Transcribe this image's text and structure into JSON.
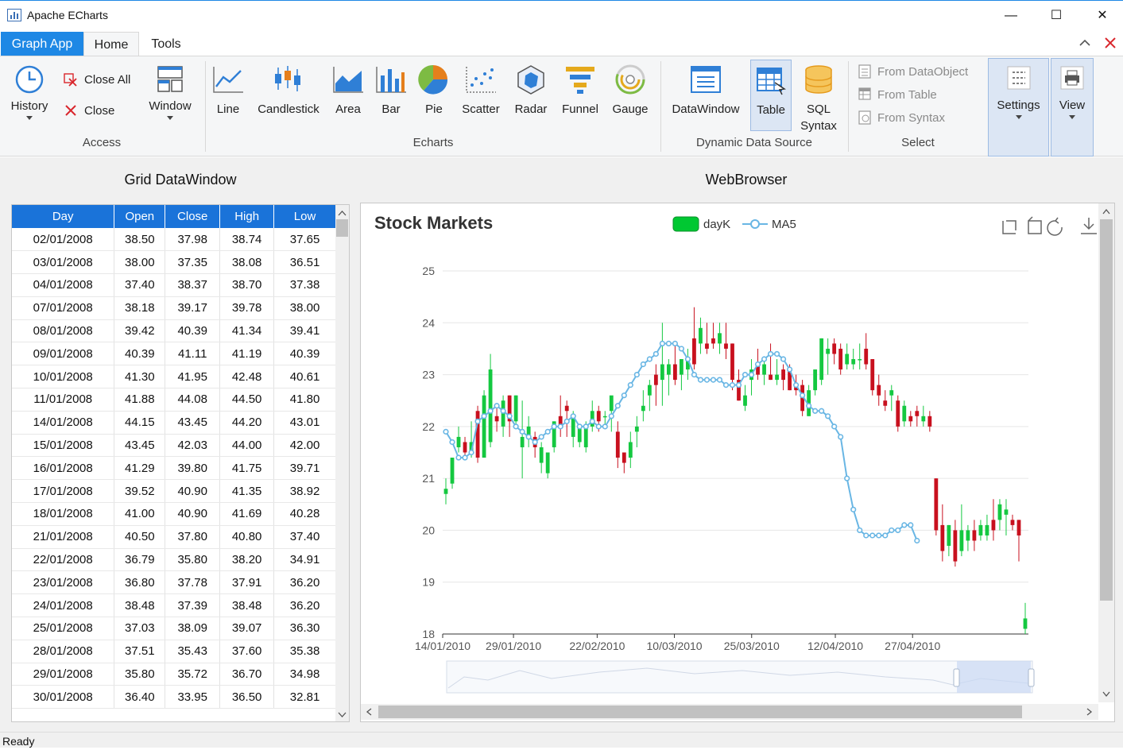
{
  "window": {
    "title": "Apache ECharts",
    "minimize": "—",
    "maximize": "☐",
    "close": "✕"
  },
  "tabs": {
    "app": "Graph App",
    "home": "Home",
    "tools": "Tools"
  },
  "ribbon": {
    "access": {
      "history": "History",
      "close_all": "Close All",
      "close": "Close",
      "window": "Window",
      "group": "Access"
    },
    "echarts": {
      "items": [
        "Line",
        "Candlestick",
        "Area",
        "Bar",
        "Pie",
        "Scatter",
        "Radar",
        "Funnel",
        "Gauge"
      ],
      "group": "Echarts"
    },
    "dds": {
      "datawindow": "DataWindow",
      "table": "Table",
      "sql": "SQL",
      "syntax": "Syntax",
      "group": "Dynamic Data Source"
    },
    "select": {
      "from_dataobject": "From DataObject",
      "from_table": "From Table",
      "from_syntax": "From Syntax",
      "group": "Select"
    },
    "settings": "Settings",
    "view": "View"
  },
  "panes": {
    "left_title": "Grid DataWindow",
    "right_title": "WebBrowser"
  },
  "grid": {
    "columns": [
      "Day",
      "Open",
      "Close",
      "High",
      "Low"
    ],
    "rows": [
      [
        "02/01/2008",
        "38.50",
        "37.98",
        "38.74",
        "37.65"
      ],
      [
        "03/01/2008",
        "38.00",
        "37.35",
        "38.08",
        "36.51"
      ],
      [
        "04/01/2008",
        "37.40",
        "38.37",
        "38.70",
        "37.38"
      ],
      [
        "07/01/2008",
        "38.18",
        "39.17",
        "39.78",
        "38.00"
      ],
      [
        "08/01/2008",
        "39.42",
        "40.39",
        "41.34",
        "39.41"
      ],
      [
        "09/01/2008",
        "40.39",
        "41.11",
        "41.19",
        "40.39"
      ],
      [
        "10/01/2008",
        "41.30",
        "41.95",
        "42.48",
        "40.61"
      ],
      [
        "11/01/2008",
        "41.88",
        "44.08",
        "44.50",
        "41.80"
      ],
      [
        "14/01/2008",
        "44.15",
        "43.45",
        "44.20",
        "43.01"
      ],
      [
        "15/01/2008",
        "43.45",
        "42.03",
        "44.00",
        "42.00"
      ],
      [
        "16/01/2008",
        "41.29",
        "39.80",
        "41.75",
        "39.71"
      ],
      [
        "17/01/2008",
        "39.52",
        "40.90",
        "41.35",
        "38.92"
      ],
      [
        "18/01/2008",
        "41.00",
        "40.90",
        "41.69",
        "40.28"
      ],
      [
        "21/01/2008",
        "40.50",
        "37.80",
        "40.80",
        "37.40"
      ],
      [
        "22/01/2008",
        "36.79",
        "35.80",
        "38.20",
        "34.91"
      ],
      [
        "23/01/2008",
        "36.80",
        "37.78",
        "37.91",
        "36.20"
      ],
      [
        "24/01/2008",
        "38.48",
        "37.39",
        "38.48",
        "36.20"
      ],
      [
        "25/01/2008",
        "37.03",
        "38.09",
        "39.07",
        "36.30"
      ],
      [
        "28/01/2008",
        "37.51",
        "35.43",
        "37.60",
        "35.38"
      ],
      [
        "29/01/2008",
        "35.80",
        "35.72",
        "36.70",
        "34.98"
      ],
      [
        "30/01/2008",
        "36.40",
        "33.95",
        "36.50",
        "32.81"
      ]
    ]
  },
  "status": "Ready",
  "colors": {
    "up": "#14c840",
    "down": "#c8101e",
    "ma": "#69b6e4",
    "accent": "#1e88e5"
  },
  "chart_data": {
    "type": "candlestick",
    "title": "Stock Markets",
    "legend": [
      "dayK",
      "MA5"
    ],
    "legend_position": "top-center",
    "yticks": [
      "25",
      "24",
      "23",
      "22",
      "21",
      "20",
      "19",
      "18"
    ],
    "ylim": [
      18,
      25
    ],
    "xticks": [
      "14/01/2010",
      "29/01/2010",
      "22/02/2010",
      "10/03/2010",
      "25/03/2010",
      "12/04/2010",
      "27/04/2010"
    ],
    "candles": [
      [
        20.7,
        20.8,
        20.5,
        21.0
      ],
      [
        20.9,
        21.4,
        20.8,
        21.4
      ],
      [
        21.6,
        21.8,
        21.5,
        22.0
      ],
      [
        21.7,
        21.5,
        21.4,
        21.8
      ],
      [
        21.5,
        21.7,
        21.4,
        22.1
      ],
      [
        22.3,
        21.4,
        21.3,
        22.4
      ],
      [
        21.4,
        22.6,
        21.4,
        22.7
      ],
      [
        21.7,
        23.1,
        21.6,
        23.4
      ],
      [
        22.2,
        22.1,
        21.9,
        22.4
      ],
      [
        22.0,
        22.5,
        21.8,
        22.6
      ],
      [
        22.6,
        22.1,
        21.8,
        22.6
      ],
      [
        22.1,
        22.6,
        22.0,
        22.6
      ],
      [
        21.6,
        21.8,
        21.0,
        22.5
      ],
      [
        21.8,
        22.0,
        21.6,
        22.2
      ],
      [
        21.8,
        21.6,
        21.4,
        21.9
      ],
      [
        21.3,
        21.6,
        21.1,
        21.7
      ],
      [
        21.1,
        21.5,
        21.0,
        21.5
      ],
      [
        21.6,
        22.1,
        21.5,
        22.1
      ],
      [
        22.2,
        22.0,
        21.8,
        22.6
      ],
      [
        22.4,
        22.3,
        21.8,
        22.5
      ],
      [
        21.8,
        22.2,
        21.6,
        22.3
      ],
      [
        21.7,
        22.0,
        21.6,
        22.0
      ],
      [
        21.6,
        22.0,
        21.5,
        22.1
      ],
      [
        22.0,
        22.3,
        21.9,
        22.5
      ],
      [
        22.3,
        22.1,
        21.9,
        22.4
      ],
      [
        22.2,
        22.2,
        22.0,
        22.3
      ],
      [
        22.3,
        22.6,
        21.9,
        22.5
      ],
      [
        21.9,
        21.4,
        21.2,
        22.1
      ],
      [
        21.5,
        21.3,
        21.1,
        21.5
      ],
      [
        21.4,
        21.7,
        21.2,
        21.9
      ],
      [
        21.9,
        22.0,
        21.6,
        22.2
      ],
      [
        22.3,
        22.4,
        22.1,
        22.7
      ],
      [
        22.6,
        22.8,
        22.3,
        22.9
      ],
      [
        23.0,
        22.8,
        22.4,
        23.2
      ],
      [
        22.9,
        23.2,
        22.4,
        24.0
      ],
      [
        23.0,
        23.2,
        22.6,
        23.3
      ],
      [
        23.2,
        22.9,
        22.8,
        23.6
      ],
      [
        23.0,
        23.3,
        22.7,
        23.3
      ],
      [
        23.1,
        23.3,
        22.9,
        23.5
      ],
      [
        23.7,
        23.2,
        23.1,
        24.3
      ],
      [
        23.6,
        23.9,
        23.4,
        24.1
      ],
      [
        23.6,
        23.5,
        23.4,
        24.0
      ],
      [
        23.7,
        23.6,
        23.5,
        24.0
      ],
      [
        23.6,
        23.8,
        23.4,
        24.0
      ],
      [
        23.6,
        23.5,
        23.3,
        24.0
      ],
      [
        23.6,
        22.9,
        22.7,
        23.6
      ],
      [
        22.9,
        22.5,
        22.5,
        23.1
      ],
      [
        22.4,
        22.6,
        22.3,
        22.8
      ],
      [
        22.9,
        23.1,
        22.6,
        23.3
      ],
      [
        23.2,
        23.0,
        22.9,
        23.5
      ],
      [
        23.0,
        23.2,
        22.8,
        23.3
      ],
      [
        23.0,
        22.9,
        22.9,
        23.6
      ],
      [
        22.9,
        23.0,
        22.8,
        23.3
      ],
      [
        23.1,
        22.9,
        22.7,
        23.2
      ],
      [
        23.1,
        22.7,
        22.7,
        23.2
      ],
      [
        22.8,
        22.7,
        22.6,
        23.0
      ],
      [
        22.8,
        22.3,
        22.2,
        22.9
      ],
      [
        22.2,
        22.7,
        22.2,
        22.8
      ],
      [
        22.7,
        23.1,
        22.6,
        23.1
      ],
      [
        22.9,
        23.7,
        22.8,
        23.7
      ],
      [
        23.4,
        23.5,
        23.0,
        23.7
      ],
      [
        23.6,
        23.4,
        23.2,
        23.7
      ],
      [
        23.5,
        23.1,
        23.0,
        23.6
      ],
      [
        23.2,
        23.4,
        23.1,
        23.6
      ],
      [
        23.2,
        23.3,
        23.1,
        23.5
      ],
      [
        23.3,
        23.3,
        23.1,
        23.6
      ],
      [
        23.5,
        23.2,
        23.1,
        23.8
      ],
      [
        23.3,
        22.7,
        22.6,
        23.3
      ],
      [
        22.8,
        22.6,
        22.4,
        23.0
      ],
      [
        22.5,
        22.4,
        22.3,
        22.7
      ],
      [
        22.6,
        22.7,
        22.3,
        22.8
      ],
      [
        22.5,
        22.0,
        21.9,
        22.6
      ],
      [
        22.1,
        22.4,
        22.0,
        22.5
      ],
      [
        22.2,
        22.1,
        22.0,
        22.3
      ],
      [
        22.3,
        22.2,
        22.0,
        22.4
      ],
      [
        22.1,
        22.2,
        22.0,
        22.4
      ],
      [
        22.2,
        22.0,
        21.9,
        22.3
      ],
      [
        21.0,
        20.0,
        19.9,
        21.0
      ],
      [
        20.1,
        19.6,
        19.4,
        20.5
      ],
      [
        19.7,
        20.1,
        19.5,
        20.1
      ],
      [
        20.0,
        19.4,
        19.3,
        20.2
      ],
      [
        19.6,
        20.0,
        19.5,
        20.5
      ],
      [
        19.8,
        20.0,
        19.6,
        20.1
      ],
      [
        20.0,
        19.8,
        19.6,
        20.2
      ],
      [
        19.9,
        20.1,
        19.8,
        20.2
      ],
      [
        19.9,
        20.1,
        19.8,
        20.3
      ],
      [
        20.2,
        20.0,
        19.8,
        20.6
      ],
      [
        20.2,
        20.5,
        20.0,
        20.6
      ],
      [
        20.3,
        20.4,
        19.9,
        20.6
      ],
      [
        20.2,
        20.1,
        20.0,
        20.3
      ],
      [
        20.2,
        19.9,
        19.4,
        20.2
      ],
      [
        18.1,
        18.3,
        18.0,
        18.6
      ]
    ],
    "ma5": [
      21.9,
      21.7,
      21.4,
      21.4,
      21.5,
      22.1,
      22.2,
      22.3,
      22.4,
      22.3,
      22.2,
      22.0,
      21.9,
      21.8,
      21.7,
      21.8,
      21.9,
      22.0,
      22.0,
      22.1,
      22.2,
      22.0,
      22.0,
      22.1,
      22.0,
      22.0,
      22.2,
      22.4,
      22.6,
      22.8,
      23.0,
      23.2,
      23.3,
      23.4,
      23.6,
      23.6,
      23.6,
      23.5,
      23.3,
      23.0,
      22.9,
      22.9,
      22.9,
      22.9,
      22.8,
      22.8,
      22.8,
      23.0,
      23.0,
      23.2,
      23.3,
      23.4,
      23.4,
      23.3,
      23.1,
      22.8,
      22.6,
      22.4,
      22.3,
      22.3,
      22.2,
      22.0,
      21.8,
      21.0,
      20.4,
      20.0,
      19.9,
      19.9,
      19.9,
      19.9,
      20.0,
      20.0,
      20.1,
      20.1,
      19.8
    ]
  }
}
